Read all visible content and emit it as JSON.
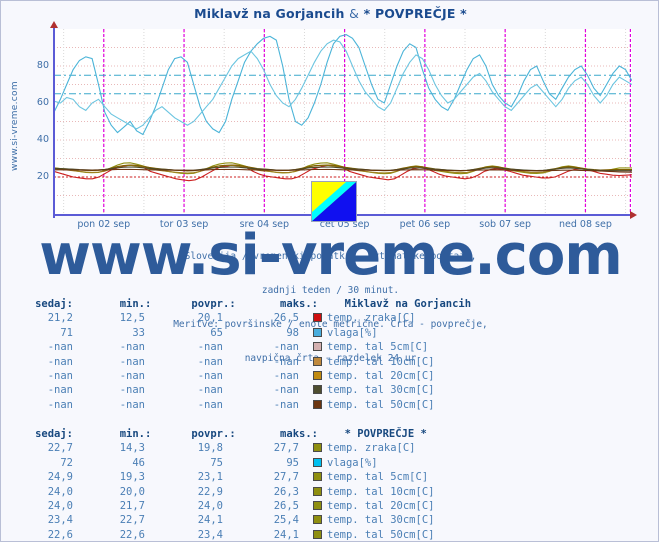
{
  "window": {
    "title": "Miklavž na Gorjancih & * POVPREČJE *",
    "title_part1": "Miklavž na Gorjancih",
    "title_amp": "&",
    "title_part2": "* POVPREČJE *",
    "site_url_vertical": "www.si-vreme.com",
    "watermark": "www.si-vreme.com"
  },
  "caption": {
    "line1": "Slovenija / vremenski podatki - avtomatske postaje,",
    "line2": "zadnji teden / 30 minut.",
    "line3": "Meritve: površinske / enote metrične. Črta - povprečje,",
    "line4": "navpična črta - razdelek 24 ur"
  },
  "chart_data": {
    "type": "line",
    "title": "Miklavž na Gorjancih & * POVPREČJE *",
    "xlabel": "",
    "ylabel": "",
    "ylim": [
      0,
      100
    ],
    "yticks": [
      20,
      40,
      60,
      80
    ],
    "x_ticks": [
      "pon 02 sep",
      "tor 03 sep",
      "sre 04 sep",
      "čet 05 sep",
      "pet 06 sep",
      "sob 07 sep",
      "ned 08 sep"
    ],
    "grid": true,
    "legend_position": "below-table",
    "day_separator": "navpična črta - razdelek 24 ur",
    "reference_lines": [
      {
        "name": "vlaga-avg-station",
        "value": 65,
        "color": "#3aa8cc",
        "style": "dash-dot"
      },
      {
        "name": "vlaga-avg-average",
        "value": 75,
        "color": "#3aa8cc",
        "style": "dash-dot"
      },
      {
        "name": "temp-zraka-avg",
        "value": 20,
        "color": "#cc2020",
        "style": "dotted"
      }
    ],
    "series": [
      {
        "name": "vlaga[%] - Miklavž na Gorjancih",
        "color": "#4bb4d8",
        "unit": "%",
        "min": 33,
        "max": 98,
        "avg": 65,
        "now": 71,
        "values": [
          55,
          62,
          70,
          78,
          83,
          85,
          84,
          70,
          55,
          48,
          44,
          47,
          50,
          45,
          43,
          50,
          58,
          68,
          78,
          84,
          85,
          82,
          70,
          58,
          50,
          46,
          44,
          50,
          62,
          72,
          82,
          88,
          92,
          95,
          96,
          94,
          80,
          62,
          50,
          48,
          52,
          60,
          70,
          82,
          92,
          96,
          97,
          95,
          90,
          80,
          70,
          62,
          60,
          70,
          80,
          88,
          92,
          90,
          78,
          68,
          62,
          58,
          56,
          62,
          70,
          78,
          84,
          86,
          80,
          70,
          64,
          60,
          58,
          64,
          72,
          78,
          80,
          72,
          65,
          62,
          68,
          74,
          78,
          80,
          75,
          68,
          64,
          70,
          76,
          80,
          78,
          72
        ]
      },
      {
        "name": "vlaga[%] - * POVPREČJE *",
        "color": "#6cc5e0",
        "unit": "%",
        "min": 46,
        "max": 95,
        "avg": 75,
        "now": 72,
        "values": [
          61,
          60,
          63,
          62,
          58,
          56,
          60,
          62,
          58,
          54,
          52,
          50,
          48,
          46,
          48,
          52,
          56,
          58,
          55,
          52,
          50,
          48,
          50,
          54,
          58,
          62,
          68,
          74,
          80,
          84,
          86,
          88,
          84,
          78,
          70,
          64,
          60,
          58,
          62,
          68,
          75,
          82,
          88,
          92,
          94,
          93,
          88,
          80,
          72,
          66,
          62,
          58,
          56,
          60,
          68,
          76,
          82,
          86,
          84,
          78,
          70,
          64,
          60,
          62,
          66,
          70,
          74,
          76,
          72,
          66,
          62,
          58,
          56,
          60,
          64,
          68,
          70,
          66,
          62,
          58,
          62,
          68,
          72,
          74,
          70,
          64,
          60,
          64,
          70,
          74,
          72,
          70
        ]
      },
      {
        "name": "temp. zraka[C] - Miklavž na Gorjancih",
        "color": "#cc2020",
        "unit": "C",
        "min": 12.5,
        "max": 26.5,
        "avg": 20.1,
        "now": 21.2,
        "values": [
          23,
          22,
          21,
          20,
          19.5,
          19,
          19,
          20,
          22,
          24,
          25,
          26,
          26.5,
          26,
          25,
          23,
          22,
          21,
          20,
          19,
          18.5,
          18,
          18.5,
          20,
          22,
          24,
          25.5,
          26,
          26.5,
          26,
          25,
          23,
          21.5,
          20.5,
          20,
          19.5,
          19,
          19,
          20,
          22,
          24,
          25,
          26,
          26.5,
          26,
          25,
          23,
          22,
          21,
          20,
          19.5,
          19,
          18.5,
          19,
          21,
          23,
          24.5,
          25,
          24.5,
          23,
          21.5,
          20.5,
          20,
          19.5,
          19,
          19.5,
          21,
          23,
          24,
          24.5,
          24,
          23,
          22,
          21,
          20.5,
          20,
          19.5,
          19.5,
          20,
          21.5,
          23,
          24,
          24.5,
          24,
          23,
          22,
          21.5,
          21,
          20.8,
          21,
          21.2
        ]
      },
      {
        "name": "temp. tal 5cm[C] - * POVPREČJE *",
        "color": "#8f8f10",
        "unit": "C",
        "min": 19.3,
        "max": 27.7,
        "avg": 23.1,
        "now": 24.9,
        "values": [
          25,
          24.5,
          24,
          23.5,
          23,
          22.5,
          22.3,
          22.5,
          23.5,
          25,
          26.5,
          27.5,
          27.7,
          27,
          26,
          25,
          24,
          23.5,
          23,
          22.5,
          22,
          21.8,
          22,
          23,
          24.5,
          26,
          27,
          27.5,
          27.7,
          27,
          26,
          25,
          24,
          23.5,
          23,
          22.5,
          22.2,
          22.3,
          23,
          24.5,
          26,
          27,
          27.5,
          27.7,
          27,
          26,
          25,
          24,
          23.5,
          23,
          22.5,
          22,
          21.8,
          22,
          23,
          24.5,
          25.5,
          26,
          25.5,
          24.5,
          23.5,
          23,
          22.5,
          22,
          21.8,
          22,
          23,
          24.5,
          25.5,
          26,
          25.5,
          24.5,
          23.5,
          23,
          22.5,
          22,
          21.9,
          22.2,
          23,
          24.5,
          25.5,
          26,
          25.5,
          24.8,
          24,
          23.5,
          23.2,
          23.5,
          24.2,
          24.9,
          24.9,
          24.9
        ]
      },
      {
        "name": "temp. tal 10cm[C] - * POVPREČJE *",
        "color": "#a08020",
        "unit": "C",
        "min": 20.0,
        "max": 26.3,
        "avg": 22.9,
        "now": 24.0,
        "values": [
          24.5,
          24.2,
          23.8,
          23.4,
          23,
          22.7,
          22.5,
          22.6,
          23.2,
          24.3,
          25.5,
          26.1,
          26.3,
          25.9,
          25.2,
          24.4,
          23.8,
          23.4,
          23,
          22.6,
          22.3,
          22.1,
          22.3,
          23,
          24,
          25.2,
          26,
          26.2,
          26.3,
          25.9,
          25.2,
          24.4,
          23.7,
          23.3,
          23,
          22.6,
          22.4,
          22.5,
          23,
          24,
          25.2,
          26,
          26.2,
          26.3,
          25.9,
          25.2,
          24.4,
          23.8,
          23.4,
          23,
          22.6,
          22.3,
          22.2,
          22.4,
          23.2,
          24.3,
          25.1,
          25.6,
          25.2,
          24.4,
          23.7,
          23.3,
          22.9,
          22.5,
          22.3,
          22.5,
          23.2,
          24.3,
          25.1,
          25.6,
          25.2,
          24.4,
          23.7,
          23.3,
          22.9,
          22.5,
          22.4,
          22.6,
          23.2,
          24.2,
          25,
          25.5,
          25.1,
          24.5,
          23.9,
          23.5,
          23.3,
          23.5,
          23.8,
          24,
          24,
          24
        ]
      },
      {
        "name": "temp. tal 20cm[C] - * POVPREČJE *",
        "color": "#806000",
        "unit": "C",
        "min": 21.7,
        "max": 26.5,
        "avg": 24.0,
        "now": 24.0,
        "values": [
          24.8,
          24.6,
          24.4,
          24.1,
          23.8,
          23.6,
          23.5,
          23.6,
          24,
          24.8,
          25.6,
          26.2,
          26.5,
          26.3,
          25.8,
          25.2,
          24.7,
          24.3,
          24,
          23.7,
          23.5,
          23.3,
          23.4,
          23.9,
          24.6,
          25.4,
          26,
          26.3,
          26.5,
          26.3,
          25.8,
          25.2,
          24.6,
          24.3,
          24,
          23.7,
          23.5,
          23.6,
          24,
          24.7,
          25.5,
          26.1,
          26.3,
          26.5,
          26.3,
          25.8,
          25.2,
          24.7,
          24.3,
          24,
          23.7,
          23.5,
          23.4,
          23.5,
          24.1,
          24.8,
          25.4,
          25.8,
          25.5,
          24.9,
          24.4,
          24,
          23.7,
          23.4,
          23.3,
          23.5,
          24,
          24.7,
          25.3,
          25.7,
          25.4,
          24.8,
          24.3,
          23.9,
          23.6,
          23.4,
          23.3,
          23.5,
          24,
          24.6,
          25.2,
          25.6,
          25.3,
          24.8,
          24.3,
          24,
          23.8,
          23.9,
          24,
          24,
          24,
          24
        ]
      },
      {
        "name": "temp. tal 30cm[C] - * POVPREČJE *",
        "color": "#4a4a2a",
        "unit": "C",
        "min": 22.7,
        "max": 25.4,
        "avg": 24.1,
        "now": 23.4,
        "values": [
          24.6,
          24.5,
          24.4,
          24.2,
          24,
          23.9,
          23.8,
          23.9,
          24.1,
          24.5,
          25,
          25.3,
          25.4,
          25.3,
          25,
          24.7,
          24.4,
          24.2,
          24,
          23.8,
          23.7,
          23.6,
          23.7,
          24,
          24.4,
          24.9,
          25.2,
          25.3,
          25.4,
          25.3,
          25,
          24.7,
          24.4,
          24.2,
          24,
          23.8,
          23.7,
          23.8,
          24,
          24.4,
          24.9,
          25.2,
          25.3,
          25.4,
          25.3,
          25,
          24.7,
          24.4,
          24.2,
          24,
          23.8,
          23.7,
          23.6,
          23.7,
          24,
          24.4,
          24.8,
          25,
          24.8,
          24.5,
          24.2,
          24,
          23.8,
          23.6,
          23.5,
          23.6,
          24,
          24.4,
          24.8,
          25,
          24.8,
          24.5,
          24.2,
          24,
          23.8,
          23.6,
          23.5,
          23.6,
          23.9,
          24.3,
          24.7,
          24.9,
          24.7,
          24.4,
          24.1,
          23.8,
          23.6,
          23.5,
          23.4,
          23.4,
          23.4,
          23.4
        ]
      },
      {
        "name": "temp. tal 50cm[C] - * POVPREČJE *",
        "color": "#6b3510",
        "unit": "C",
        "min": 22.6,
        "max": 24.1,
        "avg": 23.4,
        "now": 22.6,
        "values": [
          23.9,
          23.9,
          23.85,
          23.8,
          23.75,
          23.7,
          23.7,
          23.72,
          23.8,
          23.95,
          24.05,
          24.1,
          24.1,
          24.05,
          23.95,
          23.85,
          23.8,
          23.75,
          23.7,
          23.65,
          23.6,
          23.6,
          23.62,
          23.7,
          23.85,
          24,
          24.05,
          24.1,
          24.1,
          24.05,
          23.95,
          23.85,
          23.78,
          23.72,
          23.68,
          23.62,
          23.6,
          23.6,
          23.68,
          23.8,
          23.95,
          24.05,
          24.08,
          24.1,
          24.05,
          23.95,
          23.85,
          23.78,
          23.7,
          23.65,
          23.6,
          23.55,
          23.5,
          23.55,
          23.65,
          23.8,
          23.9,
          23.95,
          23.9,
          23.8,
          23.7,
          23.62,
          23.55,
          23.5,
          23.45,
          23.5,
          23.6,
          23.75,
          23.85,
          23.9,
          23.85,
          23.75,
          23.65,
          23.55,
          23.48,
          23.4,
          23.35,
          23.35,
          23.45,
          23.55,
          23.65,
          23.7,
          23.65,
          23.55,
          23.45,
          23.35,
          23.25,
          23.1,
          22.9,
          22.75,
          22.65,
          22.6
        ]
      }
    ]
  },
  "table_headers": {
    "sedaj": "sedaj:",
    "min": "min.:",
    "povpr": "povpr.:",
    "maks": "maks.:"
  },
  "station_table": {
    "name": "Miklavž na Gorjancih",
    "rows": [
      {
        "sedaj": "21,2",
        "min": "12,5",
        "povpr": "20,1",
        "maks": "26,5",
        "color": "#d01010",
        "label": "temp. zraka[C]"
      },
      {
        "sedaj": "71",
        "min": "33",
        "povpr": "65",
        "maks": "98",
        "color": "#49aede",
        "label": "vlaga[%]"
      },
      {
        "sedaj": "-nan",
        "min": "-nan",
        "povpr": "-nan",
        "maks": "-nan",
        "color": "#d4b0b0",
        "label": "temp. tal  5cm[C]"
      },
      {
        "sedaj": "-nan",
        "min": "-nan",
        "povpr": "-nan",
        "maks": "-nan",
        "color": "#c08a3e",
        "label": "temp. tal 10cm[C]"
      },
      {
        "sedaj": "-nan",
        "min": "-nan",
        "povpr": "-nan",
        "maks": "-nan",
        "color": "#c08a10",
        "label": "temp. tal 20cm[C]"
      },
      {
        "sedaj": "-nan",
        "min": "-nan",
        "povpr": "-nan",
        "maks": "-nan",
        "color": "#4e4e30",
        "label": "temp. tal 30cm[C]"
      },
      {
        "sedaj": "-nan",
        "min": "-nan",
        "povpr": "-nan",
        "maks": "-nan",
        "color": "#6b3510",
        "label": "temp. tal 50cm[C]"
      }
    ]
  },
  "average_table": {
    "name": "* POVPREČJE *",
    "rows": [
      {
        "sedaj": "22,7",
        "min": "14,3",
        "povpr": "19,8",
        "maks": "27,7",
        "color": "#8f8f10",
        "label": "temp. zraka[C]"
      },
      {
        "sedaj": "72",
        "min": "46",
        "povpr": "75",
        "maks": "95",
        "color": "#00c0f0",
        "label": "vlaga[%]"
      },
      {
        "sedaj": "24,9",
        "min": "19,3",
        "povpr": "23,1",
        "maks": "27,7",
        "color": "#8f8f10",
        "label": "temp. tal  5cm[C]"
      },
      {
        "sedaj": "24,0",
        "min": "20,0",
        "povpr": "22,9",
        "maks": "26,3",
        "color": "#8f8f10",
        "label": "temp. tal 10cm[C]"
      },
      {
        "sedaj": "24,0",
        "min": "21,7",
        "povpr": "24,0",
        "maks": "26,5",
        "color": "#8f8f10",
        "label": "temp. tal 20cm[C]"
      },
      {
        "sedaj": "23,4",
        "min": "22,7",
        "povpr": "24,1",
        "maks": "25,4",
        "color": "#8f8f10",
        "label": "temp. tal 30cm[C]"
      },
      {
        "sedaj": "22,6",
        "min": "22,6",
        "povpr": "23,4",
        "maks": "24,1",
        "color": "#8f8f10",
        "label": "temp. tal 50cm[C]"
      }
    ]
  },
  "logo": {
    "name": "si-vreme-logo",
    "color_top": "#ffff00",
    "color_mid": "#00ffff",
    "color_bottom": "#1010f0"
  }
}
